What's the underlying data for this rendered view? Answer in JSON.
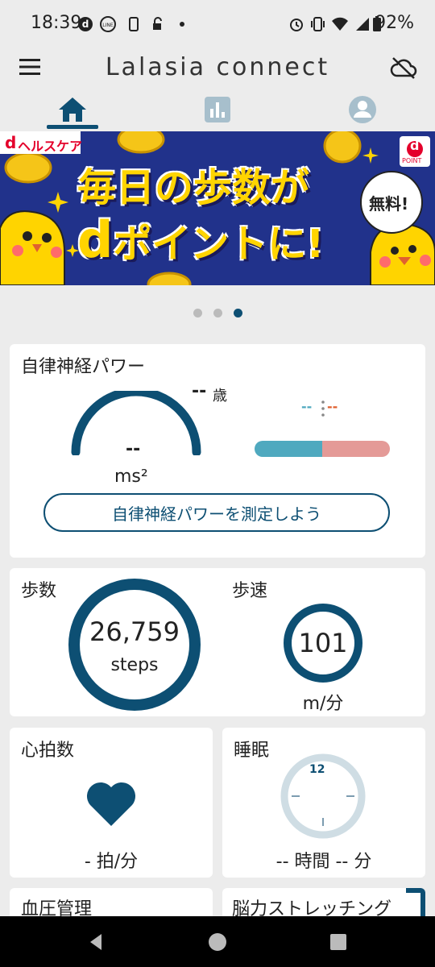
{
  "status_bar": {
    "time": "18:39",
    "battery": "92%",
    "icons": [
      "d-icon",
      "line-icon",
      "sim-icon",
      "vpn-key-icon",
      "dot-icon",
      "alarm-icon",
      "vibrate-icon",
      "wifi-icon",
      "signal-icon",
      "battery-icon"
    ]
  },
  "app_bar": {
    "title": "Lalasia connect",
    "menu_icon": "menu-icon",
    "cloud_icon": "cloud-off-icon"
  },
  "tabs": [
    {
      "icon": "home-icon",
      "active": true
    },
    {
      "icon": "bar-chart-icon",
      "active": false
    },
    {
      "icon": "account-icon",
      "active": false
    }
  ],
  "banner": {
    "brand": "ヘルスケア",
    "brand_d": "d",
    "line1": "毎日の歩数が",
    "line2_d": "d",
    "line2": "ポイントに!",
    "badge": "無料!",
    "dpoint_d": "d",
    "dpoint": "POINT"
  },
  "carousel": {
    "count": 3,
    "active_index": 2
  },
  "autonomic": {
    "title": "自律神経パワー",
    "age_value": "--",
    "age_unit": "歳",
    "power_value": "--",
    "power_unit": "ms²",
    "balance_left": "--",
    "balance_right": "--",
    "button_label": "自律神経パワーを測定しよう"
  },
  "steps": {
    "title": "歩数",
    "value": "26,759",
    "unit": "steps"
  },
  "speed": {
    "title": "歩速",
    "value": "101",
    "unit": "m/分"
  },
  "heart": {
    "title": "心拍数",
    "value": "- 拍/分"
  },
  "sleep": {
    "title": "睡眠",
    "clock_label": "12",
    "value": "-- 時間 -- 分"
  },
  "blood_pressure": {
    "title": "血圧管理"
  },
  "brain": {
    "title": "脳力ストレッチング"
  },
  "colors": {
    "primary": "#0d4f73",
    "bar_left": "#4fa9bf",
    "bar_right": "#e49a97",
    "accent_orange": "#e06030",
    "banner_bg": "#21328b",
    "banner_yellow": "#ffd400"
  }
}
